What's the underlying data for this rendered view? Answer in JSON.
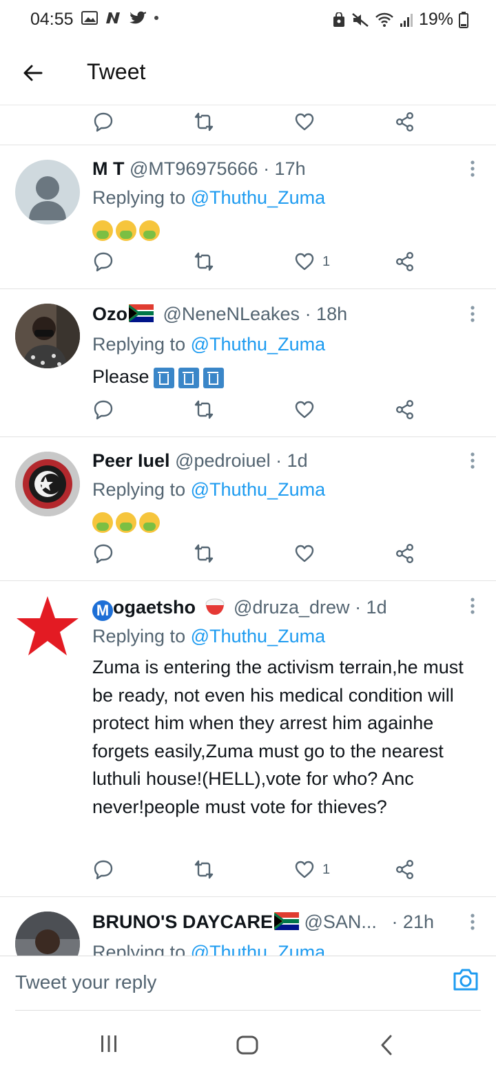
{
  "status_bar": {
    "time": "04:55",
    "battery": "19%",
    "left_icons": [
      "image-icon",
      "n-app-icon",
      "twitter-bird-icon",
      "dot-icon"
    ],
    "right_icons": [
      "security-lock-icon",
      "mute-icon",
      "wifi-icon",
      "signal-icon",
      "battery-icon"
    ]
  },
  "header": {
    "title": "Tweet"
  },
  "tweets": [
    {
      "name": "M T",
      "handle": "@MT96975666",
      "time": "· 17h",
      "reply_prefix": "Replying to",
      "reply_to": "@Thuthu_Zuma",
      "text": "",
      "emojis": [
        "nauseated-face",
        "nauseated-face",
        "nauseated-face"
      ],
      "likes": "1"
    },
    {
      "name": "Ozo",
      "handle": "@NeneNLeakes",
      "time": "· 18h",
      "reply_prefix": "Replying to",
      "reply_to": "@Thuthu_Zuma",
      "text": "Please",
      "emojis": [
        "put-litter-in-bin",
        "put-litter-in-bin",
        "put-litter-in-bin"
      ],
      "likes": ""
    },
    {
      "name": "Peer Iuel",
      "handle": "@pedroiuel",
      "time": "· 1d",
      "reply_prefix": "Replying to",
      "reply_to": "@Thuthu_Zuma",
      "text": "",
      "emojis": [
        "nauseated-face",
        "nauseated-face",
        "nauseated-face"
      ],
      "likes": ""
    },
    {
      "name": "ogaetsho",
      "name_badge": "M",
      "handle": "@druza_drew",
      "time": "· 1d",
      "reply_prefix": "Replying to",
      "reply_to": "@Thuthu_Zuma",
      "text": "Zuma is entering the activism terrain,he must be ready, not even his medical condition will protect him when they arrest him againhe forgets easily,Zuma must go to the nearest luthuli house!(HELL),vote for who? Anc never!people must vote for thieves?",
      "emojis": [],
      "likes": "1"
    },
    {
      "name": "BRUNO'S DAYCARE",
      "handle": "@SAN...",
      "time": "· 21h",
      "reply_prefix": "Replying to",
      "reply_to": "@Thuthu_Zuma",
      "text": "",
      "emojis": [],
      "likes": ""
    }
  ],
  "composer": {
    "placeholder": "Tweet your reply"
  },
  "colors": {
    "link": "#1d9bf0",
    "secondary_text": "#536471",
    "primary_text": "#0f1419",
    "red_star": "#e31b23"
  }
}
